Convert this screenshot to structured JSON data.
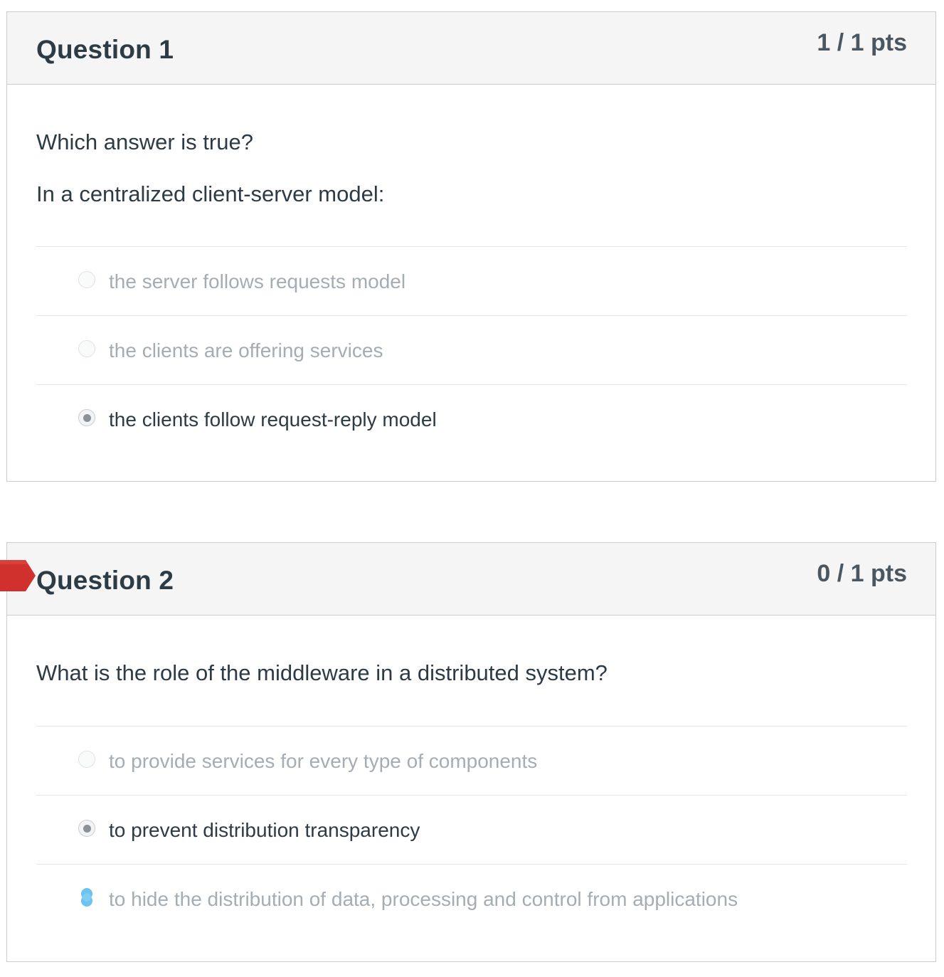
{
  "questions": [
    {
      "title": "Question 1",
      "points": "1 / 1 pts",
      "text": [
        "Which answer is true?",
        "In a centralized client-server model:"
      ],
      "answers": [
        {
          "label": "the server follows requests model",
          "selected": false
        },
        {
          "label": "the clients are offering services",
          "selected": false
        },
        {
          "label": "the clients follow request-reply model",
          "selected": true
        }
      ]
    },
    {
      "title": "Question 2",
      "points": "0 / 1 pts",
      "text": [
        "What is the role of the middleware in a distributed system?"
      ],
      "answers": [
        {
          "label": "to provide services for every type of components",
          "selected": false
        },
        {
          "label": "to prevent distribution transparency",
          "selected": true
        },
        {
          "label": "to hide the distribution of data, processing and control from applications",
          "selected": false,
          "marked_correct": true
        }
      ],
      "flag": "incorrect"
    }
  ],
  "colors": {
    "header_bg": "#f5f5f5",
    "border": "#c7cdd1",
    "incorrect_flag": "#d0312d",
    "correct_marker": "#6cc3ef",
    "muted_text": "#a6adb2",
    "text": "#2d3b45"
  }
}
